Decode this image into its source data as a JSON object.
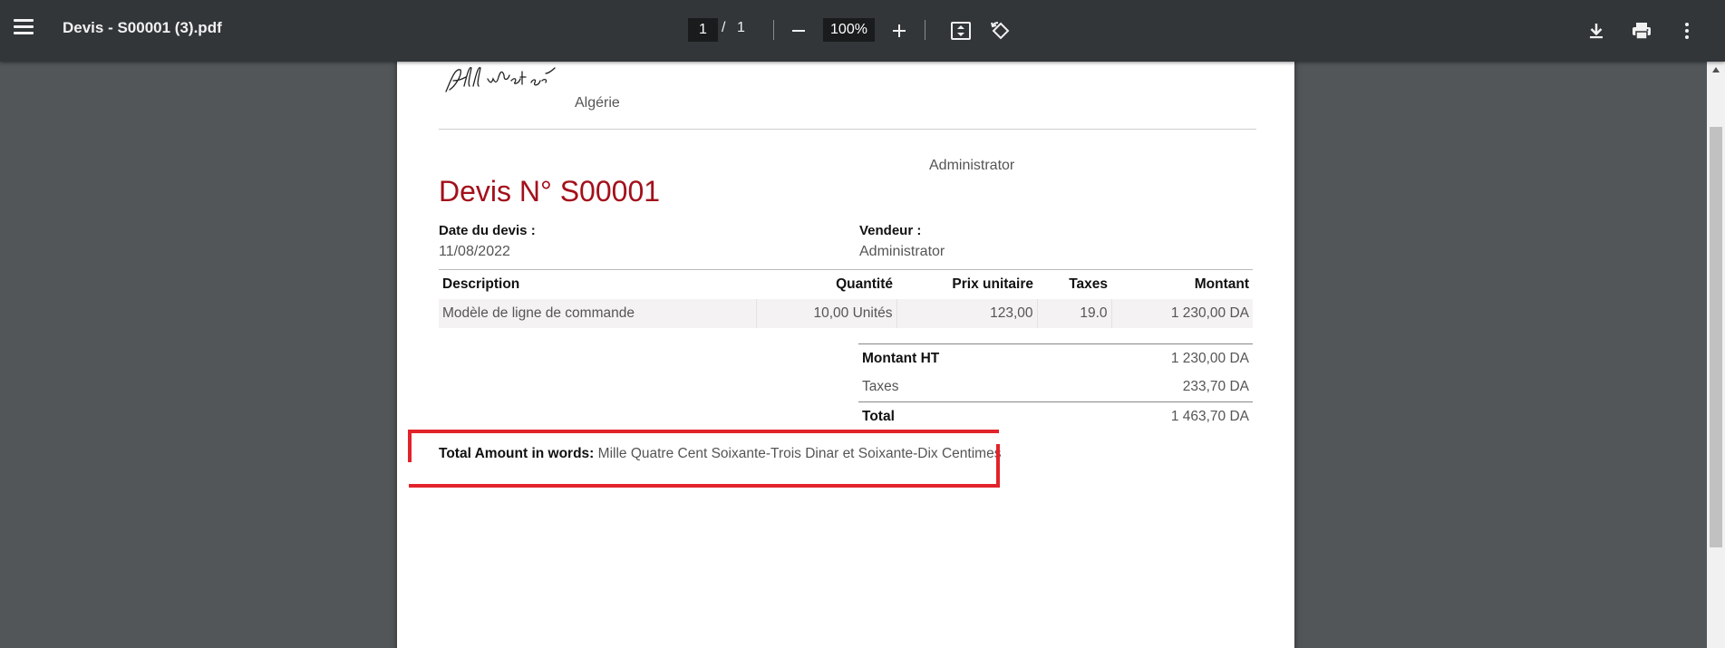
{
  "toolbar": {
    "title": "Devis - S00001 (3).pdf",
    "current_page": "1",
    "page_separator": "/",
    "total_pages": "1",
    "zoom": "100%",
    "icons": {
      "menu": "hamburger-menu-icon",
      "zoom_out": "minus-icon",
      "zoom_in": "plus-icon",
      "fit": "fit-to-page-icon",
      "rotate": "rotate-icon",
      "download": "download-icon",
      "print": "print-icon",
      "more": "more-vertical-icon"
    },
    "icon_color": "#f1f1f1",
    "background": "#323639"
  },
  "document": {
    "country": "Algérie",
    "header_contact": "Administrator",
    "title": "Devis N° S00001",
    "title_color": "#a3101b",
    "quote_date_label": "Date du devis :",
    "quote_date": "11/08/2022",
    "salesperson_label": "Vendeur :",
    "salesperson": "Administrator",
    "lines": {
      "headers": [
        "Description",
        "Quantité",
        "Prix unitaire",
        "Taxes",
        "Montant"
      ],
      "rows": [
        [
          "Modèle de ligne de commande",
          "10,00 Unités",
          "123,00",
          "19.0",
          "1 230,00 DA"
        ]
      ]
    },
    "totals": {
      "subtotal_label": "Montant HT",
      "subtotal": "1 230,00 DA",
      "taxes_label": "Taxes",
      "taxes": "233,70 DA",
      "total_label": "Total",
      "total": "1 463,70 DA"
    },
    "amount_words_label": "Total Amount in words:",
    "amount_words": "Mille Quatre Cent Soixante-Trois Dinar et Soixante-Dix Centimes"
  },
  "annotation_color": "#e2232a"
}
